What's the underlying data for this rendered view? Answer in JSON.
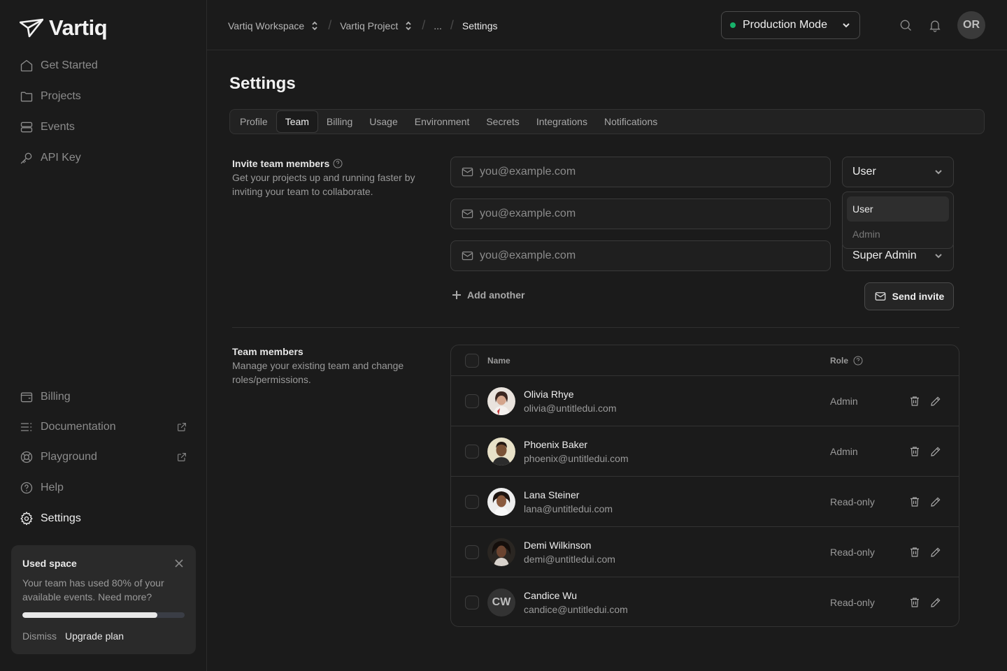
{
  "brand": {
    "name": "Vartiq"
  },
  "sidebar": {
    "top_items": [
      {
        "label": "Get Started",
        "icon": "home-icon"
      },
      {
        "label": "Projects",
        "icon": "folder-icon"
      },
      {
        "label": "Events",
        "icon": "layers-icon"
      },
      {
        "label": "API Key",
        "icon": "key-icon"
      }
    ],
    "bottom_items": [
      {
        "label": "Billing",
        "icon": "wallet-icon"
      },
      {
        "label": "Documentation",
        "icon": "list-icon"
      },
      {
        "label": "Playground",
        "icon": "lifebuoy-icon"
      },
      {
        "label": "Help",
        "icon": "help-circle-icon"
      },
      {
        "label": "Settings",
        "icon": "gear-icon",
        "active": true
      }
    ],
    "promo": {
      "title": "Used space",
      "text": "Your team has used 80% of your available events. Need more?",
      "progress_percent": 83,
      "dismiss": "Dismiss",
      "upgrade": "Upgrade plan"
    }
  },
  "header": {
    "breadcrumbs": [
      "Vartiq Workspace",
      "Vartiq Project",
      "...",
      "Settings"
    ],
    "mode": "Production Mode",
    "mode_color": "#17b26a",
    "avatar_initials": "OR"
  },
  "page": {
    "title": "Settings",
    "tabs": [
      "Profile",
      "Team",
      "Billing",
      "Usage",
      "Environment",
      "Secrets",
      "Integrations",
      "Notifications"
    ],
    "active_tab": "Team"
  },
  "invite": {
    "label": "Invite team members",
    "description": "Get your projects up and running faster by inviting your team to collaborate.",
    "email_placeholder": "you@example.com",
    "roles": [
      "User",
      "",
      "Super Admin"
    ],
    "dropdown_options": [
      "User",
      "Admin"
    ],
    "add_another": "Add another",
    "send_invite": "Send invite"
  },
  "members": {
    "label": "Team members",
    "description": "Manage your existing team and change roles/permissions.",
    "columns": {
      "name": "Name",
      "role": "Role"
    },
    "rows": [
      {
        "name": "Olivia Rhye",
        "email": "olivia@untitledui.com",
        "role": "Admin"
      },
      {
        "name": "Phoenix Baker",
        "email": "phoenix@untitledui.com",
        "role": "Admin"
      },
      {
        "name": "Lana Steiner",
        "email": "lana@untitledui.com",
        "role": "Read-only"
      },
      {
        "name": "Demi Wilkinson",
        "email": "demi@untitledui.com",
        "role": "Read-only"
      },
      {
        "name": "Candice Wu",
        "email": "candice@untitledui.com",
        "role": "Read-only",
        "initials": "CW"
      }
    ]
  }
}
